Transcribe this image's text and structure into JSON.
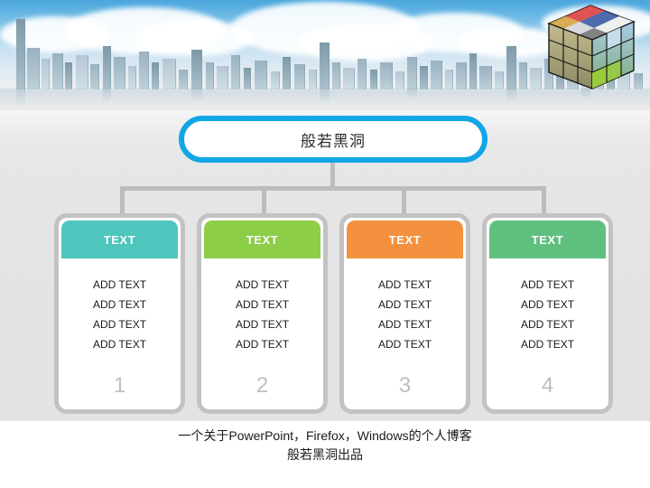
{
  "header": {
    "scene": "city-skyline-with-clouds",
    "cube_icon": "rubiks-cube-icon"
  },
  "title": {
    "text": "般若黑洞",
    "border_color": "#12a6e6",
    "fill_color": "#ffffff"
  },
  "connector": {
    "color": "#bdbdbd"
  },
  "cards": [
    {
      "header_label": "TEXT",
      "header_color": "#4ec5bd",
      "lines": [
        "ADD TEXT",
        "ADD TEXT",
        "ADD TEXT",
        "ADD TEXT"
      ],
      "number": "1"
    },
    {
      "header_label": "TEXT",
      "header_color": "#8cce47",
      "lines": [
        "ADD TEXT",
        "ADD TEXT",
        "ADD TEXT",
        "ADD TEXT"
      ],
      "number": "2"
    },
    {
      "header_label": "TEXT",
      "header_color": "#f3913e",
      "lines": [
        "ADD TEXT",
        "ADD TEXT",
        "ADD TEXT",
        "ADD TEXT"
      ],
      "number": "3"
    },
    {
      "header_label": "TEXT",
      "header_color": "#5fbf7f",
      "lines": [
        "ADD TEXT",
        "ADD TEXT",
        "ADD TEXT",
        "ADD TEXT"
      ],
      "number": "4"
    }
  ],
  "footer": {
    "line1": "一个关于PowerPoint，Firefox，Windows的个人博客",
    "line2": "般若黑洞出品"
  },
  "palette": {
    "card_border": "#c2c2c2",
    "number_color": "#bfbfbf",
    "background": "#e3e3e3",
    "sky": "#4aa6dd"
  }
}
